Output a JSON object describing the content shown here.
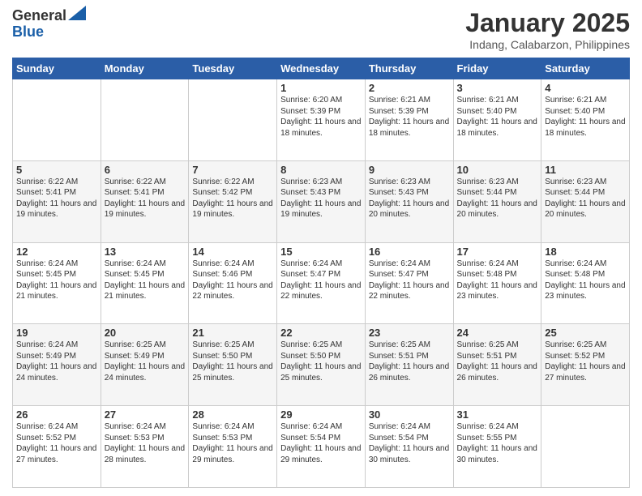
{
  "header": {
    "logo_general": "General",
    "logo_blue": "Blue",
    "month_title": "January 2025",
    "location": "Indang, Calabarzon, Philippines"
  },
  "weekdays": [
    "Sunday",
    "Monday",
    "Tuesday",
    "Wednesday",
    "Thursday",
    "Friday",
    "Saturday"
  ],
  "weeks": [
    [
      {
        "day": "",
        "sunrise": "",
        "sunset": "",
        "daylight": ""
      },
      {
        "day": "",
        "sunrise": "",
        "sunset": "",
        "daylight": ""
      },
      {
        "day": "",
        "sunrise": "",
        "sunset": "",
        "daylight": ""
      },
      {
        "day": "1",
        "sunrise": "Sunrise: 6:20 AM",
        "sunset": "Sunset: 5:39 PM",
        "daylight": "Daylight: 11 hours and 18 minutes."
      },
      {
        "day": "2",
        "sunrise": "Sunrise: 6:21 AM",
        "sunset": "Sunset: 5:39 PM",
        "daylight": "Daylight: 11 hours and 18 minutes."
      },
      {
        "day": "3",
        "sunrise": "Sunrise: 6:21 AM",
        "sunset": "Sunset: 5:40 PM",
        "daylight": "Daylight: 11 hours and 18 minutes."
      },
      {
        "day": "4",
        "sunrise": "Sunrise: 6:21 AM",
        "sunset": "Sunset: 5:40 PM",
        "daylight": "Daylight: 11 hours and 18 minutes."
      }
    ],
    [
      {
        "day": "5",
        "sunrise": "Sunrise: 6:22 AM",
        "sunset": "Sunset: 5:41 PM",
        "daylight": "Daylight: 11 hours and 19 minutes."
      },
      {
        "day": "6",
        "sunrise": "Sunrise: 6:22 AM",
        "sunset": "Sunset: 5:41 PM",
        "daylight": "Daylight: 11 hours and 19 minutes."
      },
      {
        "day": "7",
        "sunrise": "Sunrise: 6:22 AM",
        "sunset": "Sunset: 5:42 PM",
        "daylight": "Daylight: 11 hours and 19 minutes."
      },
      {
        "day": "8",
        "sunrise": "Sunrise: 6:23 AM",
        "sunset": "Sunset: 5:43 PM",
        "daylight": "Daylight: 11 hours and 19 minutes."
      },
      {
        "day": "9",
        "sunrise": "Sunrise: 6:23 AM",
        "sunset": "Sunset: 5:43 PM",
        "daylight": "Daylight: 11 hours and 20 minutes."
      },
      {
        "day": "10",
        "sunrise": "Sunrise: 6:23 AM",
        "sunset": "Sunset: 5:44 PM",
        "daylight": "Daylight: 11 hours and 20 minutes."
      },
      {
        "day": "11",
        "sunrise": "Sunrise: 6:23 AM",
        "sunset": "Sunset: 5:44 PM",
        "daylight": "Daylight: 11 hours and 20 minutes."
      }
    ],
    [
      {
        "day": "12",
        "sunrise": "Sunrise: 6:24 AM",
        "sunset": "Sunset: 5:45 PM",
        "daylight": "Daylight: 11 hours and 21 minutes."
      },
      {
        "day": "13",
        "sunrise": "Sunrise: 6:24 AM",
        "sunset": "Sunset: 5:45 PM",
        "daylight": "Daylight: 11 hours and 21 minutes."
      },
      {
        "day": "14",
        "sunrise": "Sunrise: 6:24 AM",
        "sunset": "Sunset: 5:46 PM",
        "daylight": "Daylight: 11 hours and 22 minutes."
      },
      {
        "day": "15",
        "sunrise": "Sunrise: 6:24 AM",
        "sunset": "Sunset: 5:47 PM",
        "daylight": "Daylight: 11 hours and 22 minutes."
      },
      {
        "day": "16",
        "sunrise": "Sunrise: 6:24 AM",
        "sunset": "Sunset: 5:47 PM",
        "daylight": "Daylight: 11 hours and 22 minutes."
      },
      {
        "day": "17",
        "sunrise": "Sunrise: 6:24 AM",
        "sunset": "Sunset: 5:48 PM",
        "daylight": "Daylight: 11 hours and 23 minutes."
      },
      {
        "day": "18",
        "sunrise": "Sunrise: 6:24 AM",
        "sunset": "Sunset: 5:48 PM",
        "daylight": "Daylight: 11 hours and 23 minutes."
      }
    ],
    [
      {
        "day": "19",
        "sunrise": "Sunrise: 6:24 AM",
        "sunset": "Sunset: 5:49 PM",
        "daylight": "Daylight: 11 hours and 24 minutes."
      },
      {
        "day": "20",
        "sunrise": "Sunrise: 6:25 AM",
        "sunset": "Sunset: 5:49 PM",
        "daylight": "Daylight: 11 hours and 24 minutes."
      },
      {
        "day": "21",
        "sunrise": "Sunrise: 6:25 AM",
        "sunset": "Sunset: 5:50 PM",
        "daylight": "Daylight: 11 hours and 25 minutes."
      },
      {
        "day": "22",
        "sunrise": "Sunrise: 6:25 AM",
        "sunset": "Sunset: 5:50 PM",
        "daylight": "Daylight: 11 hours and 25 minutes."
      },
      {
        "day": "23",
        "sunrise": "Sunrise: 6:25 AM",
        "sunset": "Sunset: 5:51 PM",
        "daylight": "Daylight: 11 hours and 26 minutes."
      },
      {
        "day": "24",
        "sunrise": "Sunrise: 6:25 AM",
        "sunset": "Sunset: 5:51 PM",
        "daylight": "Daylight: 11 hours and 26 minutes."
      },
      {
        "day": "25",
        "sunrise": "Sunrise: 6:25 AM",
        "sunset": "Sunset: 5:52 PM",
        "daylight": "Daylight: 11 hours and 27 minutes."
      }
    ],
    [
      {
        "day": "26",
        "sunrise": "Sunrise: 6:24 AM",
        "sunset": "Sunset: 5:52 PM",
        "daylight": "Daylight: 11 hours and 27 minutes."
      },
      {
        "day": "27",
        "sunrise": "Sunrise: 6:24 AM",
        "sunset": "Sunset: 5:53 PM",
        "daylight": "Daylight: 11 hours and 28 minutes."
      },
      {
        "day": "28",
        "sunrise": "Sunrise: 6:24 AM",
        "sunset": "Sunset: 5:53 PM",
        "daylight": "Daylight: 11 hours and 29 minutes."
      },
      {
        "day": "29",
        "sunrise": "Sunrise: 6:24 AM",
        "sunset": "Sunset: 5:54 PM",
        "daylight": "Daylight: 11 hours and 29 minutes."
      },
      {
        "day": "30",
        "sunrise": "Sunrise: 6:24 AM",
        "sunset": "Sunset: 5:54 PM",
        "daylight": "Daylight: 11 hours and 30 minutes."
      },
      {
        "day": "31",
        "sunrise": "Sunrise: 6:24 AM",
        "sunset": "Sunset: 5:55 PM",
        "daylight": "Daylight: 11 hours and 30 minutes."
      },
      {
        "day": "",
        "sunrise": "",
        "sunset": "",
        "daylight": ""
      }
    ]
  ]
}
